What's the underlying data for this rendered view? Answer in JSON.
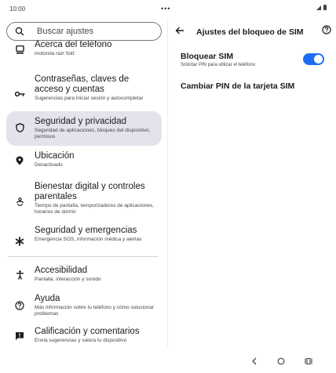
{
  "status_bar": {
    "time": "10:00",
    "dots": "•••"
  },
  "search": {
    "placeholder": "Buscar ajustes"
  },
  "settings_list": [
    {
      "title": "Acerca del teléfono",
      "subtitle": "motorola razr fold",
      "icon": "phone-info-icon"
    },
    {
      "title": "Contraseñas, claves de acceso y cuentas",
      "subtitle": "Sugerencias para iniciar sesión y autocompletar",
      "icon": "key-icon"
    },
    {
      "title": "Seguridad y privacidad",
      "subtitle": "Seguridad de aplicaciones, bloqueo del dispositivo, permisos",
      "icon": "shield-icon",
      "selected": true
    },
    {
      "title": "Ubicación",
      "subtitle": "Desactivado",
      "icon": "location-pin-icon"
    },
    {
      "title": "Bienestar digital y controles parentales",
      "subtitle": "Tiempo de pantalla, temporizadores de aplicaciones, horarios de dormir",
      "icon": "wellbeing-icon"
    },
    {
      "title": "Seguridad y emergencias",
      "subtitle": "Emergencia SOS, información médica y alertas",
      "icon": "asterisk-icon"
    },
    {
      "title": "Accesibilidad",
      "subtitle": "Pantalla, interacción y sonido",
      "icon": "accessibility-icon"
    },
    {
      "title": "Ayuda",
      "subtitle": "Más información sobre tu teléfono y cómo solucionar problemas",
      "icon": "help-circle-icon"
    },
    {
      "title": "Calificación y comentarios",
      "subtitle": "Envía sugerencias y valora tu dispositivo",
      "icon": "feedback-icon"
    }
  ],
  "detail": {
    "title": "Ajustes del bloqueo de SIM",
    "lock_sim": {
      "title": "Bloquear SIM",
      "subtitle": "Solicitar PIN para utilizar el teléfono",
      "enabled": true
    },
    "change_pin": {
      "title": "Cambiar PIN de la tarjeta SIM"
    }
  },
  "colors": {
    "accent": "#1b6ef3",
    "selected_bg": "#e4e2ea"
  }
}
